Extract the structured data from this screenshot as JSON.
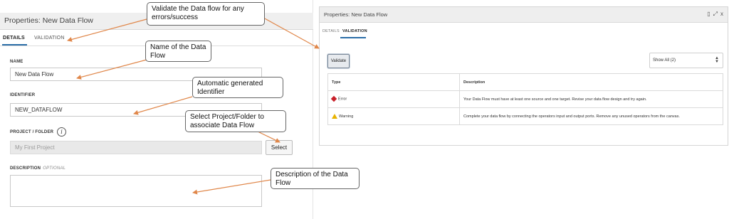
{
  "left_panel": {
    "title": "Properties: New Data Flow",
    "tabs": {
      "details": "DETAILS",
      "validation": "VALIDATION"
    },
    "fields": {
      "name_label": "NAME",
      "name_value": "New Data Flow",
      "identifier_label": "IDENTIFIER",
      "identifier_value": "NEW_DATAFLOW",
      "project_label": "PROJECT / FOLDER",
      "project_placeholder": "My First Project",
      "select_button": "Select",
      "description_label": "DESCRIPTION",
      "description_optional": "OPTIONAL",
      "info_icon": "i"
    }
  },
  "callouts": {
    "validate": "Validate the Data flow for any errors/success",
    "name": "Name of the Data Flow",
    "identifier": "Automatic generated Identifier",
    "project": "Select Project/Folder to associate Data Flow",
    "description": "Description of the Data Flow"
  },
  "right_panel": {
    "title": "Properties: New Data Flow",
    "header_icons": [
      "restore-icon",
      "expand-icon",
      "close-icon"
    ],
    "header_icon_glyphs": [
      "▯",
      "⤢",
      "x"
    ],
    "tabs": {
      "details": "DETAILS",
      "validation": "VALIDATION"
    },
    "validate_button": "Validate",
    "filter_value": "Show All (2)",
    "table": {
      "headers": {
        "type": "Type",
        "description": "Description"
      },
      "rows": [
        {
          "type": "Error",
          "icon": "error-diamond-icon",
          "description": "Your Data Flow must have at least one source and one target. Revise your data flow design and try again."
        },
        {
          "type": "Warning",
          "icon": "warning-triangle-icon",
          "description": "Complete your data flow by connecting the operators input and output ports. Remove any unused operators from the canvas."
        }
      ]
    }
  },
  "colors": {
    "accent": "#2b6ea8",
    "arrow": "#e0874a",
    "error": "#c8202a",
    "warning": "#e8b300"
  }
}
